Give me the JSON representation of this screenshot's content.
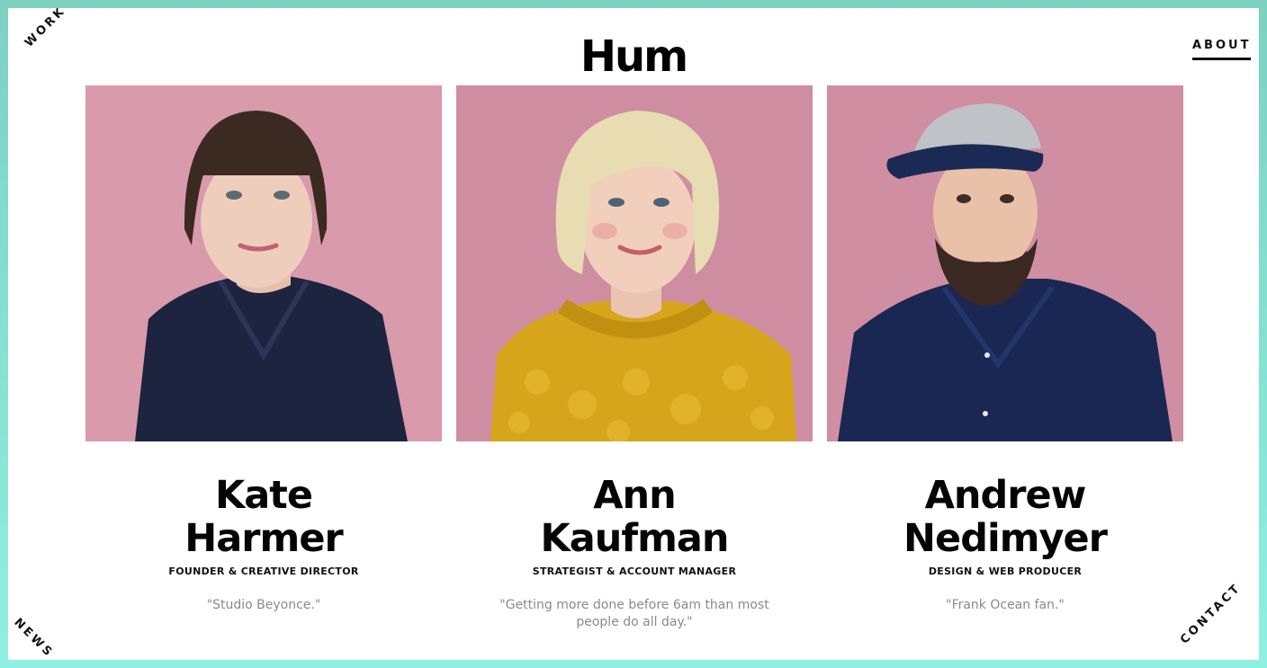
{
  "site": {
    "logo": "Hum"
  },
  "nav": {
    "work": "WORK",
    "about": "ABOUT",
    "news": "NEWS",
    "contact": "CONTACT"
  },
  "colors": {
    "frame_border": "#8ef0e2",
    "photo_background": "#d99aac",
    "quote_text": "#8a8a8a"
  },
  "team": [
    {
      "first_name": "Kate",
      "last_name": "Harmer",
      "role": "FOUNDER & CREATIVE DIRECTOR",
      "quote": "\"Studio Beyonce.\""
    },
    {
      "first_name": "Ann",
      "last_name": "Kaufman",
      "role": "STRATEGIST & ACCOUNT MANAGER",
      "quote": "\"Getting more done before 6am than most people do all day.\""
    },
    {
      "first_name": "Andrew",
      "last_name": "Nedimyer",
      "role": "DESIGN & WEB PRODUCER",
      "quote": "\"Frank Ocean fan.\""
    }
  ]
}
